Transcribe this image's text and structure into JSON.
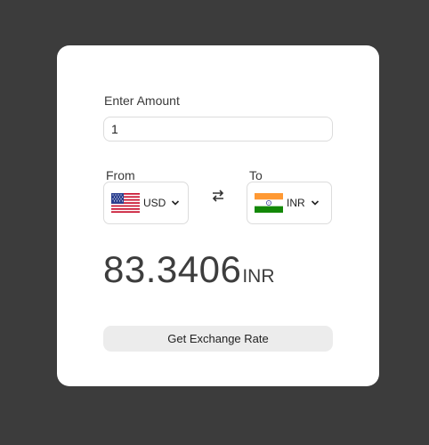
{
  "form": {
    "amount_label": "Enter Amount",
    "amount_value": "1",
    "from_label": "From",
    "to_label": "To",
    "from_currency": {
      "code": "USD",
      "flag_icon": "us-flag-icon"
    },
    "to_currency": {
      "code": "INR",
      "flag_icon": "india-flag-icon"
    },
    "swap_icon": "swap-arrows-icon",
    "dropdown_icon": "chevron-down-icon"
  },
  "result": {
    "value": "83.3406",
    "unit": "INR"
  },
  "actions": {
    "get_rate_label": "Get Exchange Rate"
  },
  "colors": {
    "page_background": "#3c3c3c",
    "card_background": "#ffffff",
    "text": "#3d3d3d",
    "button_background": "#ececec",
    "border": "#dcdcdc"
  }
}
